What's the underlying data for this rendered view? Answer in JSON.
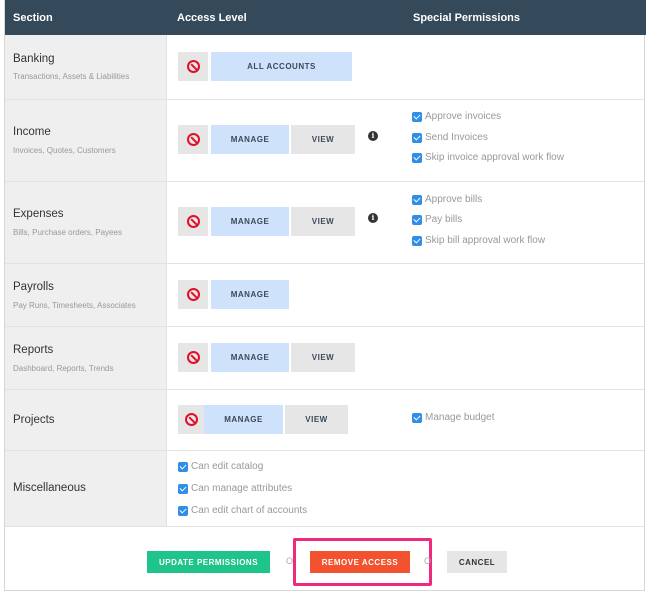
{
  "header": {
    "section": "Section",
    "access_level": "Access Level",
    "special_permissions": "Special Permissions"
  },
  "rows": {
    "banking": {
      "title": "Banking",
      "sub": "Transactions, Assets & Liabilities",
      "all_accounts": "ALL ACCOUNTS"
    },
    "income": {
      "title": "Income",
      "sub": "Invoices, Quotes, Customers",
      "manage": "MANAGE",
      "view": "VIEW",
      "perms": [
        "Approve invoices",
        "Send Invoices",
        "Skip invoice approval work flow"
      ]
    },
    "expenses": {
      "title": "Expenses",
      "sub": "Bills, Purchase orders, Payees",
      "manage": "MANAGE",
      "view": "VIEW",
      "perms": [
        "Approve bills",
        "Pay bills",
        "Skip bill approval work flow"
      ]
    },
    "payrolls": {
      "title": "Payrolls",
      "sub": "Pay Runs, Timesheets, Associates",
      "manage": "MANAGE"
    },
    "reports": {
      "title": "Reports",
      "sub": "Dashboard, Reports, Trends",
      "manage": "MANAGE",
      "view": "VIEW"
    },
    "projects": {
      "title": "Projects",
      "manage": "MANAGE",
      "view": "VIEW",
      "perms": [
        "Manage budget"
      ]
    },
    "misc": {
      "title": "Miscellaneous",
      "perms": [
        "Can edit catalog",
        "Can manage attributes",
        "Can edit chart of accounts"
      ]
    }
  },
  "footer": {
    "update": "UPDATE PERMISSIONS",
    "or1": "O",
    "remove": "REMOVE ACCESS",
    "or2": "O",
    "cancel": "CANCEL"
  },
  "icons": {
    "deny": "no-entry-icon",
    "info": "info-icon",
    "check": "checkbox-checked-icon"
  },
  "colors": {
    "header": "#34495a",
    "update": "#1ec48a",
    "remove": "#f2522e",
    "highlight": "#f0287e",
    "deny": "#e0102a",
    "selected": "#cfe2fb"
  }
}
